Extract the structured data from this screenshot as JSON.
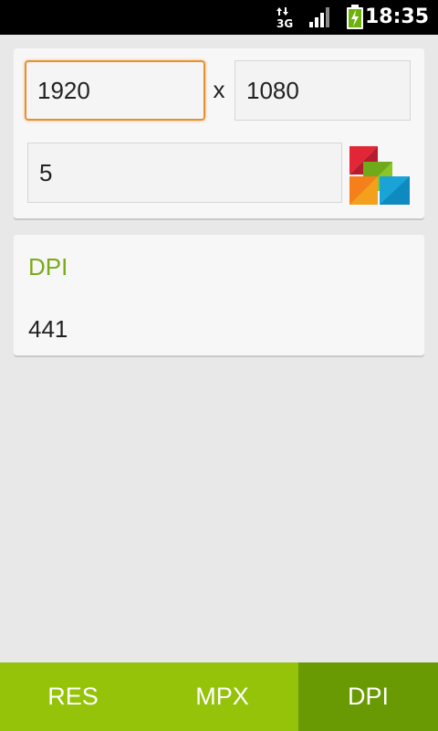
{
  "status_bar": {
    "network_label": "3G",
    "time": "18:35"
  },
  "inputs": {
    "width_value": "1920",
    "height_value": "1080",
    "times_symbol": "x",
    "diagonal_value": "5"
  },
  "result": {
    "title": "DPI",
    "value": "441"
  },
  "tabs": [
    {
      "label": "RES",
      "selected": false
    },
    {
      "label": "MPX",
      "selected": false
    },
    {
      "label": "DPI",
      "selected": true
    }
  ],
  "colors": {
    "accent_green": "#95c30a",
    "selected_tab": "#6a9a03",
    "result_title": "#7bab1a",
    "focus_orange": "#e8902c"
  }
}
